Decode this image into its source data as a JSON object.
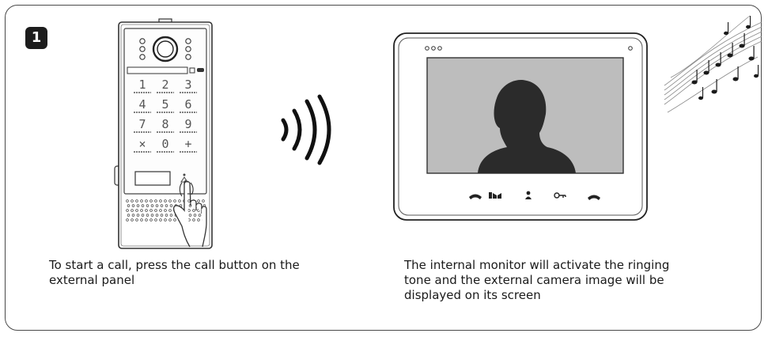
{
  "step": {
    "number": "1"
  },
  "panel": {
    "keypad_rows": [
      [
        "1",
        "2",
        "3"
      ],
      [
        "4",
        "5",
        "6"
      ],
      [
        "7",
        "8",
        "9"
      ],
      [
        "×",
        "0",
        "+"
      ]
    ]
  },
  "captions": {
    "left": "To start a call, press the call button on the external panel",
    "right": "The internal monitor will activate the ringing tone and the external camera image will be displayed on its screen"
  },
  "monitor": {
    "buttons": [
      "answer-call-icon",
      "gate-icon",
      "user-icon",
      "door-key-icon",
      "hang-up-icon"
    ]
  }
}
